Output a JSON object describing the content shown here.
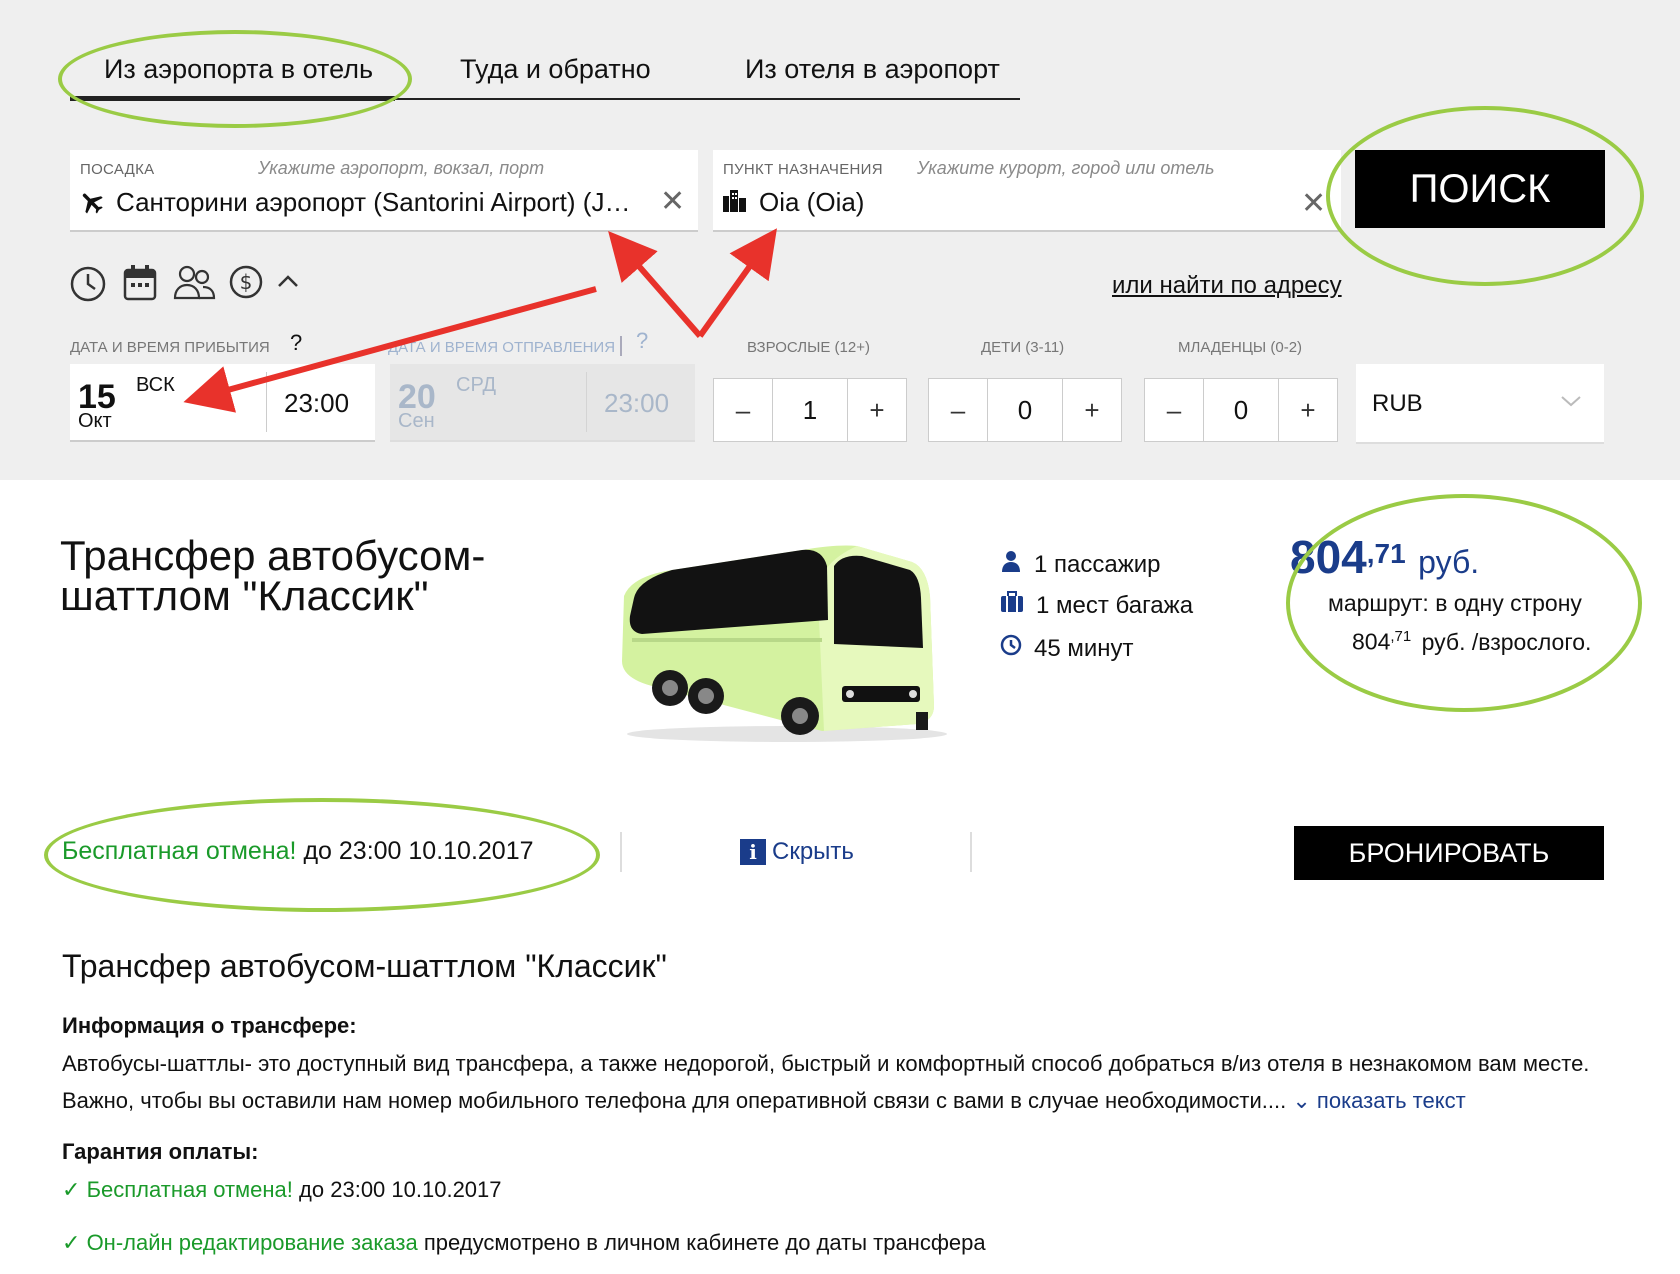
{
  "tabs": [
    {
      "label": "Из аэропорта в отель"
    },
    {
      "label": "Туда и обратно"
    },
    {
      "label": "Из отеля в аэропорт"
    }
  ],
  "pickup": {
    "label": "ПОСАДКА",
    "hint": "Укажите аэропорт, вокзал, порт",
    "value": "Санторини аэропорт (Santorini Airport) (JTR),..."
  },
  "destination": {
    "label": "ПУНКТ НАЗНАЧЕНИЯ",
    "hint": "Укажите курорт, город или отель",
    "value": "Oia (Oia)"
  },
  "search_button": "ПОИСК",
  "address_link": "или найти по адресу",
  "arrival": {
    "label": "ДАТА И ВРЕМЯ ПРИБЫТИЯ",
    "help": "?",
    "day": "15",
    "weekday": "ВСК",
    "month": "Окт",
    "time": "23:00"
  },
  "departure": {
    "label": "ДАТА И ВРЕМЯ ОТПРАВЛЕНИЯ",
    "help": "?",
    "day": "20",
    "weekday": "СРД",
    "month": "Сен",
    "time": "23:00"
  },
  "adults": {
    "label": "ВЗРОСЛЫЕ (12+)",
    "value": "1"
  },
  "children": {
    "label": "ДЕТИ (3-11)",
    "value": "0"
  },
  "infants": {
    "label": "МЛАДЕНЦЫ (0-2)",
    "value": "0"
  },
  "stepper": {
    "minus": "–",
    "plus": "+"
  },
  "currency": {
    "selected": "RUB"
  },
  "result": {
    "title": "Трансфер автобусом-шаттлом \"Классик\"",
    "passengers": "1 пассажир",
    "luggage": "1 мест багажа",
    "duration": "45 минут",
    "price_int": "804",
    "price_dec": ",71",
    "price_currency": "руб.",
    "route": "маршрут: в одну строну",
    "per_adult_int": "804",
    "per_adult_dec": ",71",
    "per_adult_suffix": "руб. /взрослого.",
    "free_cancel": "Бесплатная отмена!",
    "free_cancel_until": "до 23:00 10.10.2017",
    "hide_label": "Скрыть",
    "book_button": "БРОНИРОВАТЬ"
  },
  "details": {
    "title": "Трансфер автобусом-шаттлом \"Классик\"",
    "info_heading": "Информация о трансфере:",
    "info_line1": "Автобусы-шаттлы- это доступный вид трансфера, а также недорогой, быстрый и комфортный способ добраться в/из отеля в незнакомом вам месте.",
    "info_line2": "Важно, чтобы вы оставили нам номер мобильного телефона для оперативной связи с вами в случае необходимости....",
    "show_text": "показать текст",
    "guarantee_heading": "Гарантия оплаты:",
    "g1_green": "Бесплатная отмена!",
    "g1_rest": "до 23:00 10.10.2017",
    "g2_green": "Он-лайн редактирование заказа",
    "g2_rest": "предусмотрено в личном кабинете до даты трансфера"
  },
  "colors": {
    "highlight": "#9acb45",
    "arrow": "#e8322b",
    "price": "#1a3c8a",
    "free": "#1a9a2a"
  }
}
